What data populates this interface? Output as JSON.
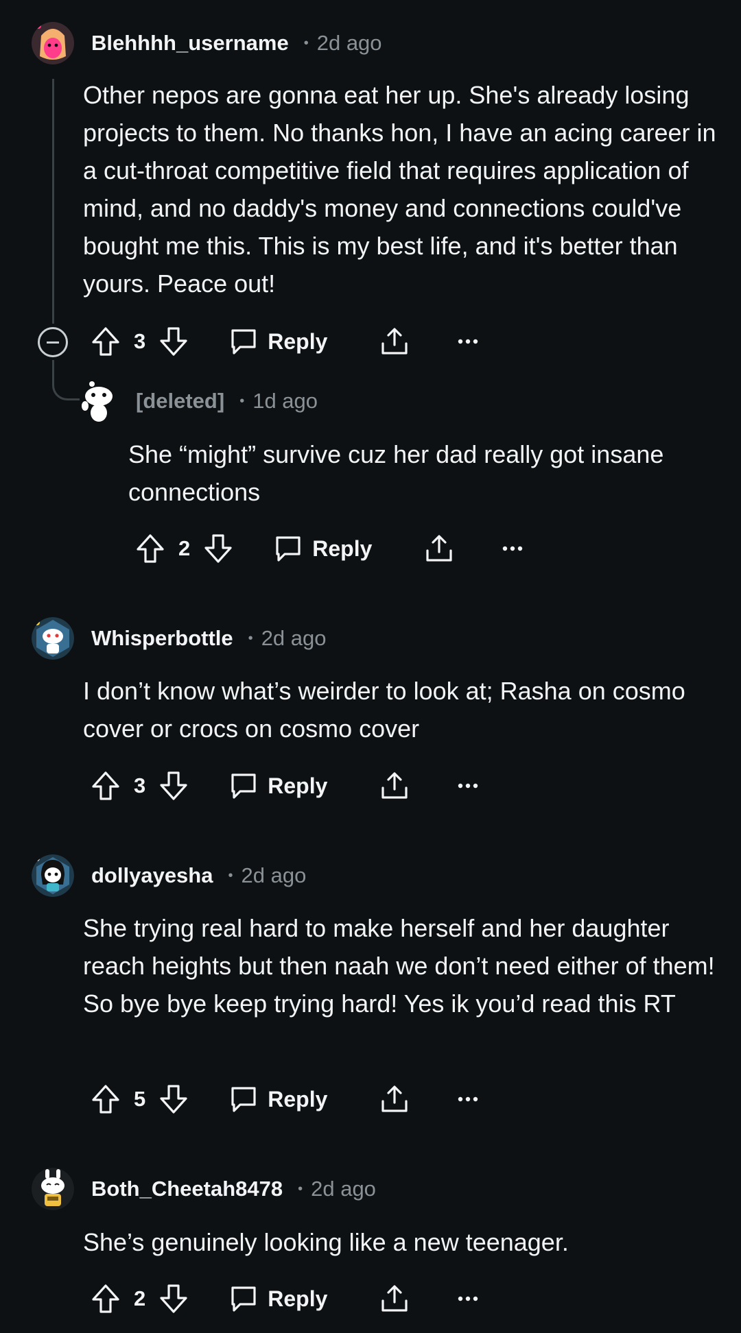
{
  "comments": [
    {
      "username": "Blehhhh_username",
      "time": "2d ago",
      "body": "Other nepos are gonna eat her up. She's already losing projects to them. No thanks hon, I have an acing career in a cut-throat competitive field that requires application of mind, and no daddy's money and connections could've bought me this. This is my best life, and it's better than yours. Peace out!",
      "score": "3",
      "reply_label": "Reply"
    },
    {
      "username": "[deleted]",
      "time": "1d ago",
      "body": "She “might” survive cuz her dad really got insane connections",
      "score": "2",
      "reply_label": "Reply"
    },
    {
      "username": "Whisperbottle",
      "time": "2d ago",
      "body": "I don’t know what’s weirder to look at; Rasha on cosmo cover or crocs on cosmo cover",
      "score": "3",
      "reply_label": "Reply"
    },
    {
      "username": "dollyayesha",
      "time": "2d ago",
      "body": "She trying real hard to make herself and her daughter reach heights but then naah we don’t need either of them! So bye bye keep trying hard! Yes ik you’d read this RT",
      "score": "5",
      "reply_label": "Reply"
    },
    {
      "username": "Both_Cheetah8478",
      "time": "2d ago",
      "body": "She’s genuinely looking like a new teenager.",
      "score": "2",
      "reply_label": "Reply"
    }
  ],
  "icons": {
    "upvote": "upvote-arrow-icon",
    "downvote": "downvote-arrow-icon",
    "reply": "speech-bubble-icon",
    "share": "share-upload-icon",
    "more": "ellipsis-icon",
    "collapse": "collapse-minus-icon"
  },
  "colors": {
    "background": "#0e1113",
    "text": "#f2f4f5",
    "meta": "#8a9297"
  }
}
